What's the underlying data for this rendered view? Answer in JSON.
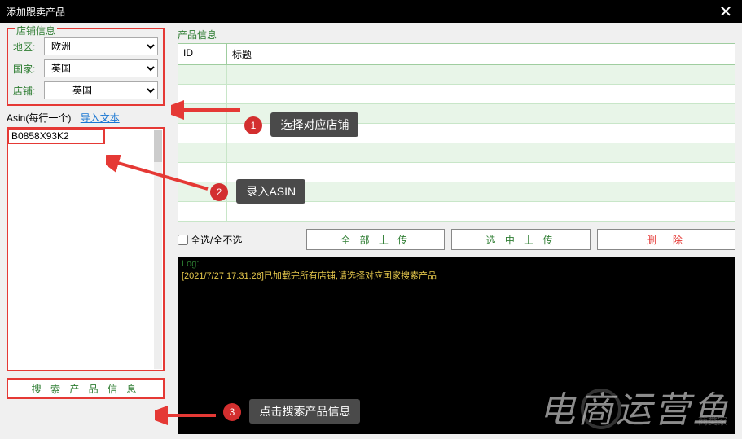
{
  "window": {
    "title": "添加跟卖产品"
  },
  "store_info": {
    "legend": "店铺信息",
    "region_label": "地区:",
    "region_value": "欧洲",
    "country_label": "国家:",
    "country_value": "英国",
    "store_label": "店铺:",
    "store_value": "英国"
  },
  "asin": {
    "header": "Asin(每行一个)",
    "import_link": "导入文本",
    "value": "B0858X93K2"
  },
  "search_button": "搜 索 产 品 信 息",
  "product_info": {
    "legend": "产品信息",
    "col_id": "ID",
    "col_title": "标题"
  },
  "actions": {
    "select_all": "全选/全不选",
    "upload_all": "全 部 上 传",
    "upload_selected": "选 中 上 传",
    "delete": "删　除"
  },
  "log": {
    "label": "Log:",
    "line1": "[2021/7/27 17:31:26]已加载完所有店铺,请选择对应国家搜索产品"
  },
  "annotations": {
    "step1": "选择对应店铺",
    "step2": "录入ASIN",
    "step3": "点击搜索产品信息"
  },
  "watermark": "电商运营鱼"
}
